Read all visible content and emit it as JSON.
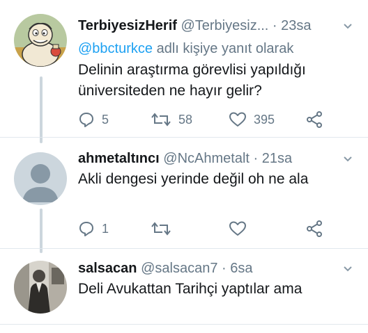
{
  "tweets": [
    {
      "name": "TerbiyesizHerif",
      "handle": "@Terbiyesiz...",
      "separator": "·",
      "time": "23sa",
      "reply_prefix": "@bbcturkce",
      "reply_suffix": " adlı kişiye yanıt olarak",
      "text_line1": "Delinin araştırma görevlisi yapıldığı",
      "text_line2": "üniversiteden ne hayır gelir?",
      "replies": "5",
      "retweets": "58",
      "likes": "395",
      "avatar_icon": "cartoon-character-avatar"
    },
    {
      "name": "ahmetaltıncı",
      "handle": "@NcAhmetalt",
      "separator": "·",
      "time": "21sa",
      "text_line1": "Akli dengesi yerinde değil oh ne ala",
      "replies": "1",
      "retweets": "",
      "likes": "",
      "avatar_icon": "default-profile-avatar"
    },
    {
      "name": "salsacan",
      "handle": "@salsacan7",
      "separator": "·",
      "time": "6sa",
      "text_line1": "Deli Avukattan Tarihçi yaptılar ama",
      "avatar_icon": "photo-avatar"
    }
  ],
  "colors": {
    "accent": "#1da1f2",
    "secondary_text": "#657786",
    "thread_line": "#ccd6dd",
    "divider": "#e1e8ed"
  }
}
